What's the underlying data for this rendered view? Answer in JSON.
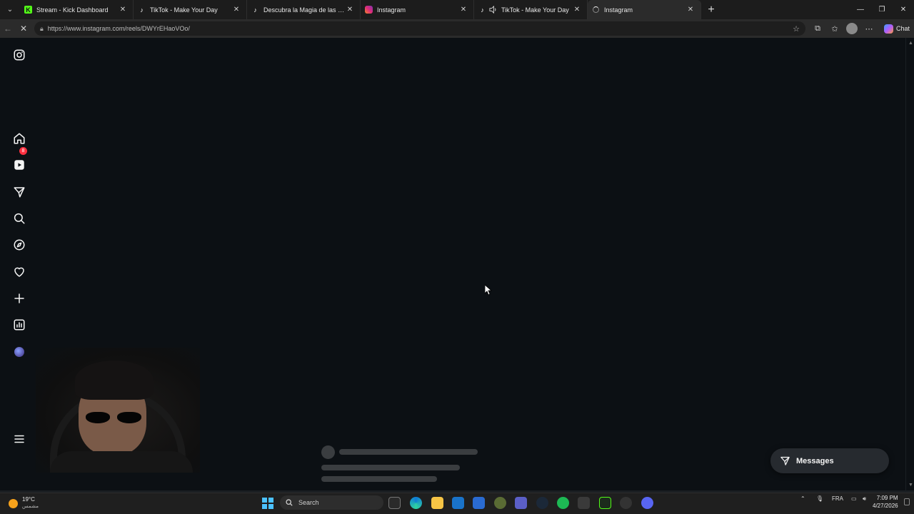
{
  "browser": {
    "tabs": [
      {
        "title": "Stream - Kick Dashboard",
        "favicon": "kick-logo-icon",
        "active": false
      },
      {
        "title": "TikTok - Make Your Day",
        "favicon": "tiktok-logo-icon",
        "active": false
      },
      {
        "title": "Descubra la Magia de las Flores de",
        "favicon": "tiktok-logo-icon",
        "active": false
      },
      {
        "title": "Instagram",
        "favicon": "instagram-logo-icon",
        "active": false
      },
      {
        "title": "TikTok - Make Your Day",
        "favicon": "tiktok-logo-icon",
        "muted_icon": "speaker-icon",
        "active": false
      },
      {
        "title": "Instagram",
        "favicon": "loading-spinner-icon",
        "active": true
      }
    ],
    "url": "https://www.instagram.com/reels/DWYrEHaoVOo/",
    "chat_label": "Chat"
  },
  "sidebar": {
    "icons": [
      "instagram-logo-icon",
      "home-icon",
      "reels-icon",
      "direct-messages-icon",
      "search-icon",
      "explore-icon",
      "notifications-heart-icon",
      "create-plus-icon",
      "dashboard-icon",
      "profile-avatar",
      "more-menu-icon"
    ],
    "notification_badge": "8"
  },
  "messages_button": {
    "label": "Messages"
  },
  "taskbar": {
    "weather": {
      "temp": "19°C",
      "condition": "مشمس"
    },
    "search_placeholder": "Search",
    "language": "FRA",
    "time": "7:09 PM",
    "date": "4/27/2026"
  },
  "colors": {
    "page_bg": "#0c1014",
    "badge": "#ff3040",
    "skeleton": "#3a3d40",
    "messages_bg": "#262a2f"
  }
}
